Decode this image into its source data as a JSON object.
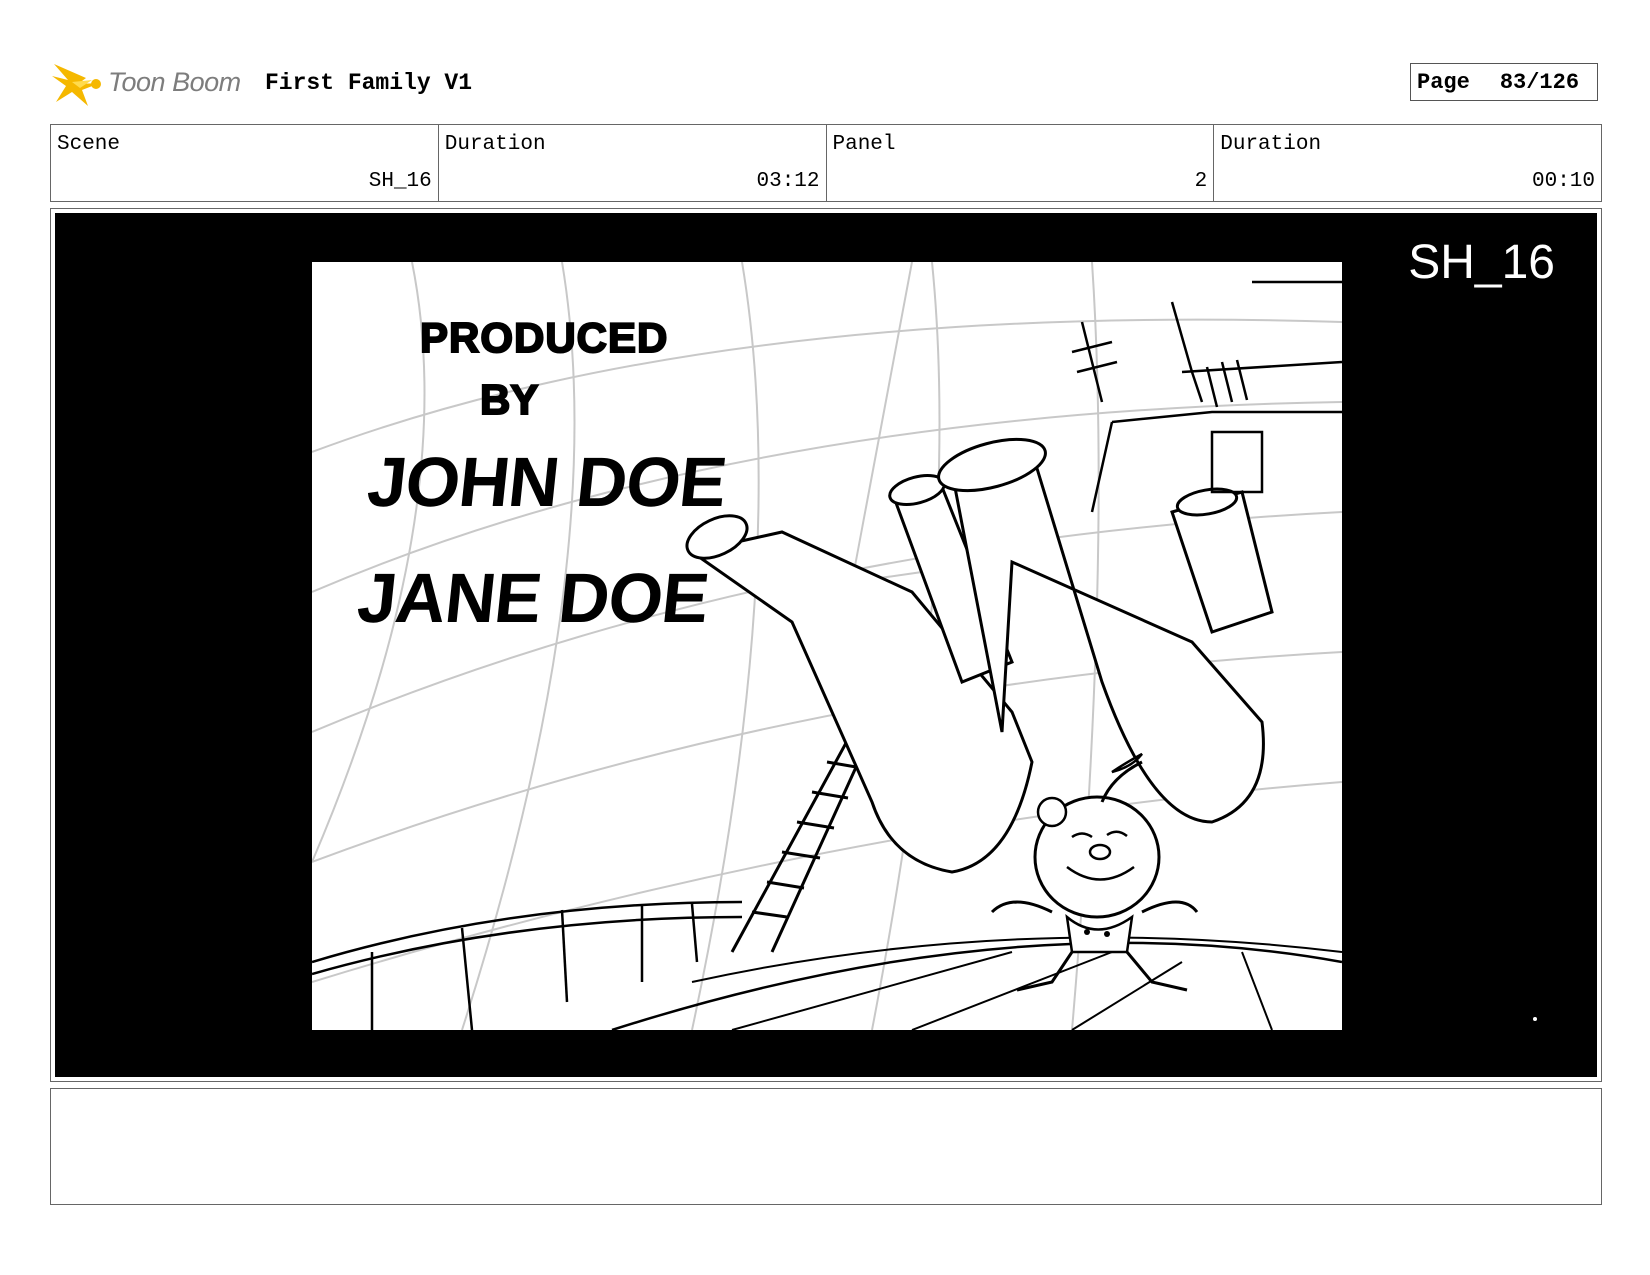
{
  "header": {
    "logo_text": "Toon Boom",
    "project_title": "First Family V1",
    "page_label": "Page",
    "page_number": "83/126"
  },
  "info": {
    "scene_label": "Scene",
    "scene_value": "SH_16",
    "scene_duration_label": "Duration",
    "scene_duration_value": "03:12",
    "panel_label": "Panel",
    "panel_value": "2",
    "panel_duration_label": "Duration",
    "panel_duration_value": "00:10"
  },
  "panel": {
    "shot_label": "SH_16",
    "credits": {
      "line1": "PRODUCED",
      "line2": "BY",
      "name1": "JOHN DOE",
      "name2": "JANE DOE"
    }
  },
  "notes": {
    "text": ""
  },
  "colors": {
    "logo_accent": "#f5b800",
    "frame_background": "#000000",
    "grid_lines": "#c8c8c8"
  },
  "icons": {
    "logo": "toon-boom-star-icon"
  }
}
